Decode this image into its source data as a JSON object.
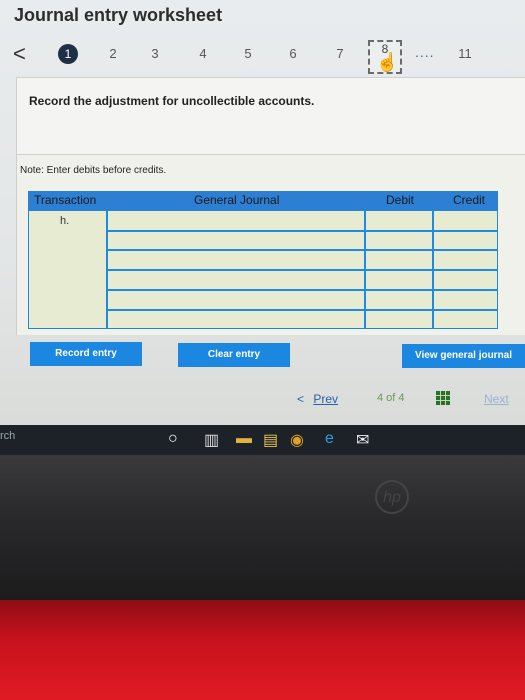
{
  "app": {
    "title": "Journal entry worksheet"
  },
  "pager": {
    "back_symbol": "<",
    "steps": [
      "1",
      "2",
      "3",
      "4",
      "5",
      "6",
      "7",
      "8"
    ],
    "active_step": "1",
    "current_step": "8",
    "ellipsis": "....",
    "last_step": "11"
  },
  "instruction": {
    "text": "Record the adjustment for uncollectible accounts."
  },
  "note": {
    "text": "Note: Enter debits before credits."
  },
  "table": {
    "columns": [
      "Transaction",
      "General Journal",
      "Debit",
      "Credit"
    ],
    "transaction_value": "h.",
    "rows": [
      {
        "transaction": "h.",
        "account": "",
        "debit": "",
        "credit": ""
      },
      {
        "transaction": "",
        "account": "",
        "debit": "",
        "credit": ""
      },
      {
        "transaction": "",
        "account": "",
        "debit": "",
        "credit": ""
      },
      {
        "transaction": "",
        "account": "",
        "debit": "",
        "credit": ""
      },
      {
        "transaction": "",
        "account": "",
        "debit": "",
        "credit": ""
      },
      {
        "transaction": "",
        "account": "",
        "debit": "",
        "credit": ""
      }
    ]
  },
  "buttons": {
    "record": "Record entry",
    "clear": "Clear entry",
    "view": "View general journal"
  },
  "navigation": {
    "prev": "Prev",
    "page_info": "4 of 4",
    "next": "Next"
  },
  "taskbar": {
    "search_fragment": "rch"
  },
  "colors": {
    "accent": "#1b87e0",
    "header": "#2d7fd3",
    "table_body": "#e6ebd2",
    "keyboard": "#d0141e"
  }
}
